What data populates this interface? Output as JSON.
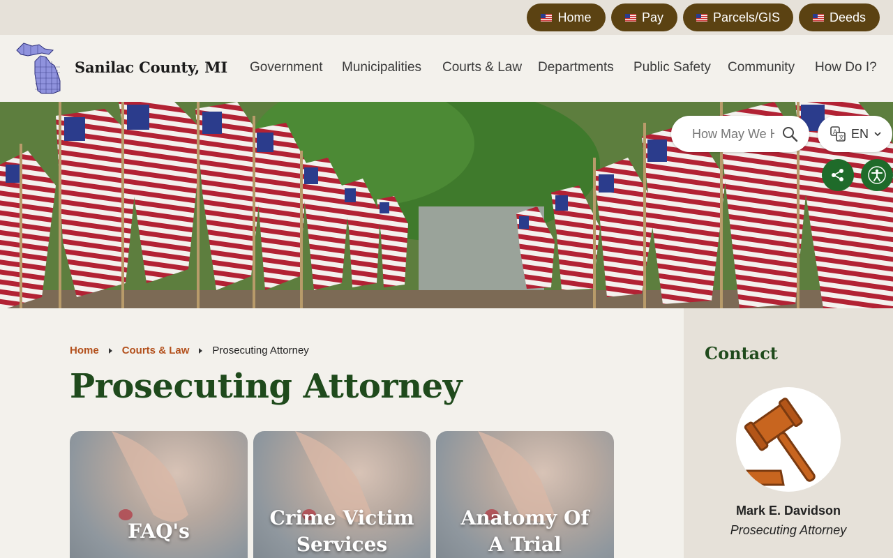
{
  "utility": {
    "links": [
      {
        "label": "Home",
        "icon": "flag-icon"
      },
      {
        "label": "Pay",
        "icon": "flag-icon"
      },
      {
        "label": "Parcels/GIS",
        "icon": "flag-icon"
      },
      {
        "label": "Deeds",
        "icon": "flag-icon"
      }
    ]
  },
  "header": {
    "site_name": "Sanilac County, MI",
    "nav": [
      "Government",
      "Municipalities",
      "Courts & Law",
      "Departments",
      "Public Safety",
      "Community",
      "How Do I?"
    ]
  },
  "search": {
    "placeholder": "How May We Help You?"
  },
  "language": {
    "label": "EN"
  },
  "breadcrumb": {
    "home": "Home",
    "section": "Courts & Law",
    "current": "Prosecuting Attorney"
  },
  "page": {
    "title": "Prosecuting Attorney"
  },
  "cards": [
    {
      "label": "FAQ's"
    },
    {
      "label": "Crime Victim Services"
    },
    {
      "label": "Anatomy Of A Trial"
    }
  ],
  "contact": {
    "heading": "Contact",
    "name": "Mark E. Davidson",
    "role": "Prosecuting Attorney"
  },
  "colors": {
    "utility_button": "#5b4212",
    "title_green": "#1f4a1c",
    "breadcrumb_link": "#b3501c",
    "round_button": "#1f6b2a"
  }
}
